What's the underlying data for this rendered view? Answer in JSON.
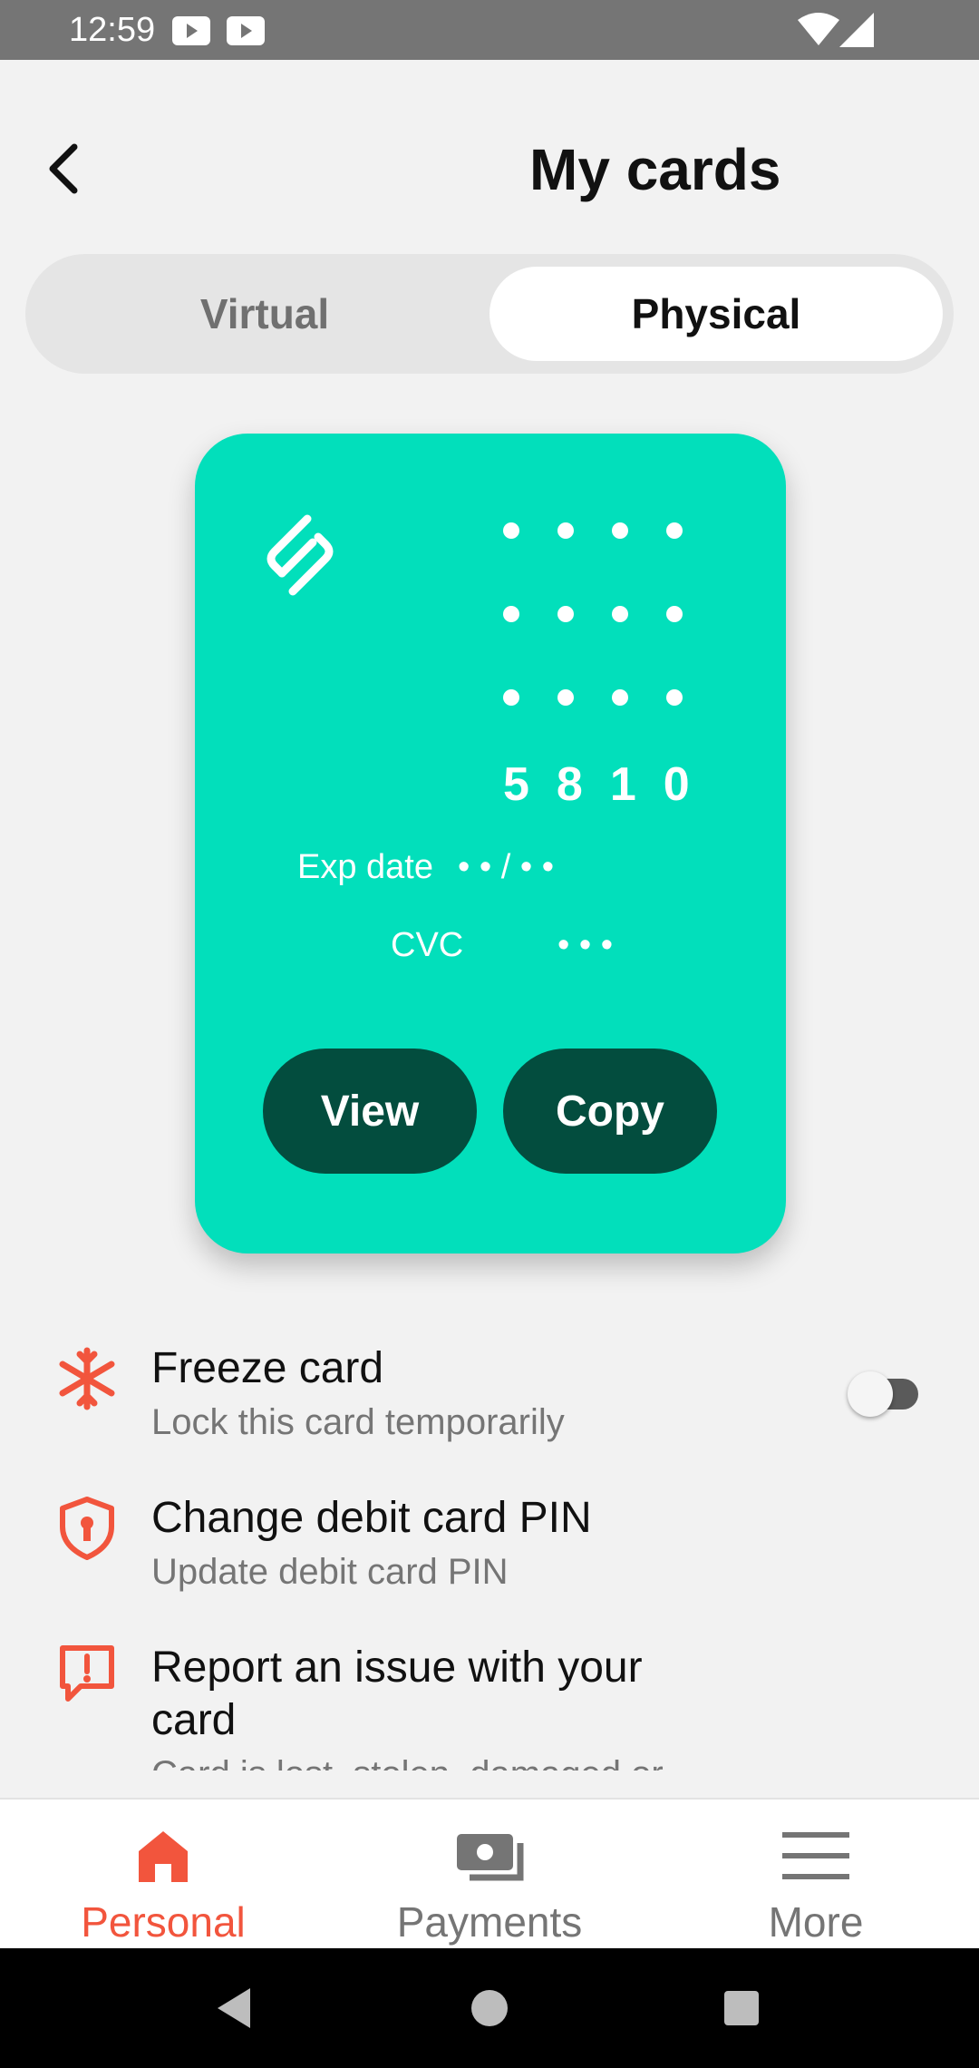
{
  "status_bar": {
    "time": "12:59",
    "icons": [
      "youtube-icon",
      "youtube-icon",
      "wifi-icon",
      "signal-icon"
    ]
  },
  "header": {
    "title": "My cards",
    "back_icon": "chevron-left-icon"
  },
  "tabs": [
    {
      "label": "Virtual",
      "selected": false
    },
    {
      "label": "Physical",
      "selected": true
    }
  ],
  "card": {
    "background_color": "#02dfbb",
    "button_color": "#034d3e",
    "last4": "5810",
    "exp_label": "Exp date",
    "exp_value": "•  • / •  •",
    "cvc_label": "CVC",
    "cvc_value": "•  •  •",
    "view_label": "View",
    "copy_label": "Copy"
  },
  "settings": [
    {
      "title": "Freeze card",
      "subtitle": "Lock this card temporarily",
      "icon": "snowflake-icon",
      "toggle_on": false
    },
    {
      "title": "Change debit card PIN",
      "subtitle": "Update debit card PIN",
      "icon": "shield-lock-icon"
    },
    {
      "title": "Report an issue with your card",
      "subtitle": "Card is lost, stolen, damaged or",
      "icon": "report-icon"
    }
  ],
  "bottom_nav": [
    {
      "label": "Personal",
      "icon": "home-icon",
      "active": true
    },
    {
      "label": "Payments",
      "icon": "payments-icon",
      "active": false
    },
    {
      "label": "More",
      "icon": "menu-icon",
      "active": false
    }
  ],
  "colors": {
    "accent": "#f2553d",
    "background": "#f2f2f2"
  }
}
